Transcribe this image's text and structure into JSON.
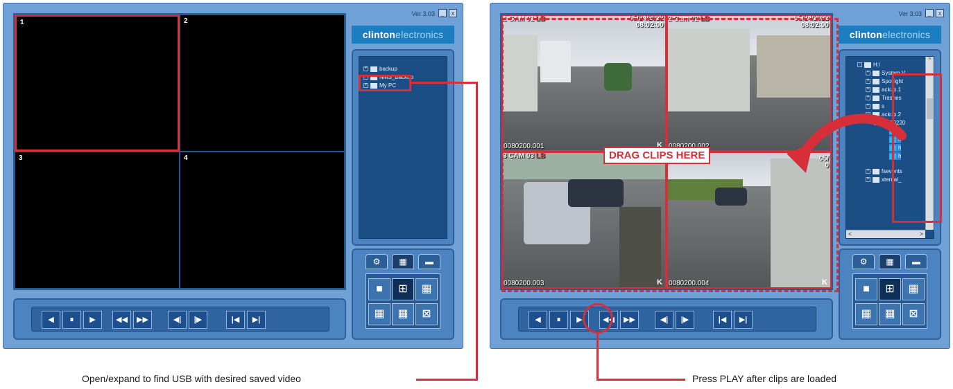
{
  "left_panel": {
    "version": "Ver 3.03",
    "min_label": "_",
    "close_label": "x",
    "brand_bold": "clinton",
    "brand_light": "electronics",
    "cells": [
      "1",
      "2",
      "3",
      "4"
    ],
    "tree": [
      {
        "label": "backup"
      },
      {
        "label": "NMS_Backup"
      },
      {
        "label": "My PC"
      }
    ],
    "tabs": [
      "⚙",
      "▦",
      "▬"
    ],
    "layouts": [
      "■",
      "⊞",
      "▦",
      "▦",
      "▦",
      "⊠"
    ],
    "transport": [
      "◀",
      "⏸",
      "▶",
      "◀◀",
      "▶▶",
      "◀|",
      "|▶",
      "|◀",
      "▶|"
    ]
  },
  "right_panel": {
    "version": "Ver 3.03",
    "min_label": "_",
    "close_label": "x",
    "brand_bold": "clinton",
    "brand_light": "electronics",
    "tree": [
      {
        "label": "H:\\"
      },
      {
        "label": "System V"
      },
      {
        "label": "Spotlight"
      },
      {
        "label": "ackup.1"
      },
      {
        "label": "Trashes"
      },
      {
        "label": "s"
      },
      {
        "label": "ackup.2"
      },
      {
        "label": "20220"
      },
      {
        "label": "h"
      },
      {
        "label": "h"
      },
      {
        "label": "h"
      },
      {
        "label": "h"
      },
      {
        "label": "fsevents"
      },
      {
        "label": "xternal_"
      }
    ],
    "scroll_left": "<",
    "scroll_right": ">",
    "scroll_up": "^",
    "cameras": [
      {
        "label": "1 CAM 01",
        "lb": "LB",
        "date": "05/24/2022",
        "time": "08:02:00",
        "file": "0080200.001"
      },
      {
        "label": "2 Cam 02",
        "lb": "LB",
        "date": "05/24/2022",
        "time": "08:02:00",
        "file": "0080200.002"
      },
      {
        "label": "3 CAM 03",
        "lb": "LB",
        "date": "05/",
        "time": "0",
        "file": "0080200.003"
      },
      {
        "label": "",
        "lb": "",
        "date": "",
        "time": "",
        "file": "0080200.004"
      }
    ],
    "cam_mark": "K"
  },
  "annotations": {
    "drag_clips": "DRAG CLIPS HERE",
    "left_caption": "Open/expand to find USB with desired saved video",
    "right_caption": "Press PLAY after clips are loaded"
  },
  "colors": {
    "accent_red": "#d62f3a",
    "panel_blue": "#6fa1d6",
    "brand_blue": "#1b7ec0"
  }
}
